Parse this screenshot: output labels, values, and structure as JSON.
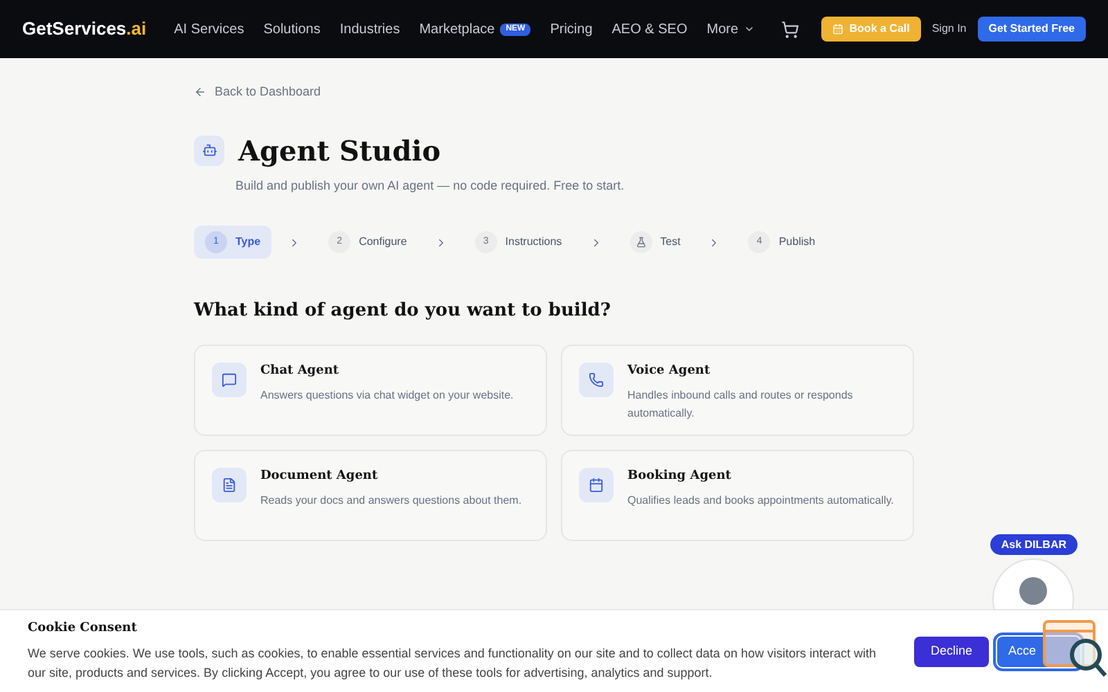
{
  "navbar": {
    "logo": {
      "main": "GetServices",
      "suffix": ".ai"
    },
    "links": [
      {
        "label": "AI Services"
      },
      {
        "label": "Solutions"
      },
      {
        "label": "Industries"
      },
      {
        "label": "Marketplace",
        "badge": "NEW"
      },
      {
        "label": "Pricing"
      },
      {
        "label": "AEO & SEO"
      },
      {
        "label": "More",
        "dropdown": true
      }
    ],
    "book_call": "Book a Call",
    "sign_in": "Sign In",
    "get_started": "Get Started Free"
  },
  "back_link": "Back to Dashboard",
  "title": "Agent Studio",
  "subtitle": "Build and publish your own AI agent — no code required. Free to start.",
  "steps": [
    {
      "number": "1",
      "label": "Type",
      "selected": true,
      "kind": "number"
    },
    {
      "number": "2",
      "label": "Configure",
      "selected": false,
      "kind": "number"
    },
    {
      "number": "3",
      "label": "Instructions",
      "selected": false,
      "kind": "number"
    },
    {
      "label": "Test",
      "selected": false,
      "kind": "flask"
    },
    {
      "number": "4",
      "label": "Publish",
      "selected": false,
      "kind": "number"
    }
  ],
  "question": "What kind of agent do you want to build?",
  "agents": [
    {
      "kind": "chat",
      "title": "Chat Agent",
      "description": "Answers questions via chat widget on your website."
    },
    {
      "kind": "voice",
      "title": "Voice Agent",
      "description": "Handles inbound calls and routes or responds automatically."
    },
    {
      "kind": "document",
      "title": "Document Agent",
      "description": "Reads your docs and answers questions about them."
    },
    {
      "kind": "booking",
      "title": "Booking Agent",
      "description": "Qualifies leads and books appointments automatically."
    }
  ],
  "assistant": {
    "label": "Ask DILBAR"
  },
  "cookie": {
    "title": "Cookie Consent",
    "text": "We serve cookies. We use tools, such as cookies, to enable essential services and functionality on our site and to collect data on how visitors interact with our site, products and services. By clicking Accept, you agree to our use of these tools for advertising, analytics and support.",
    "decline": "Decline",
    "accept": "Acce"
  }
}
